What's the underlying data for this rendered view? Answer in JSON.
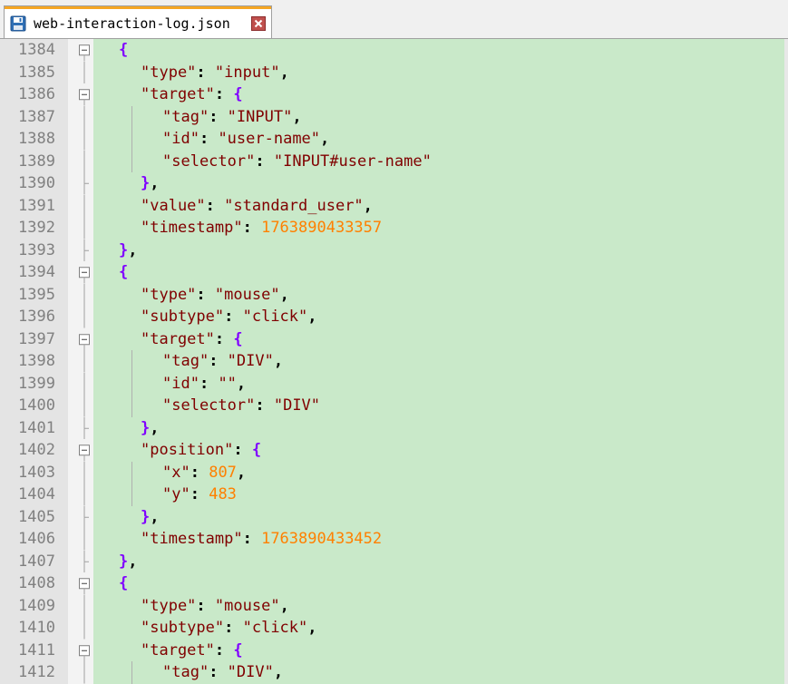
{
  "tab": {
    "title": "web-interaction-log.json",
    "save_icon": "floppy-disk-icon",
    "close_icon": "close-icon",
    "accent_color": "#f5a623"
  },
  "editor": {
    "highlight_color": "#c9e9c9",
    "lines": [
      {
        "n": "1384",
        "fold": "open",
        "indent": 1,
        "tokens": [
          {
            "t": "brace",
            "v": "{"
          }
        ]
      },
      {
        "n": "1385",
        "fold": "line",
        "indent": 2,
        "tokens": [
          {
            "t": "key",
            "v": "\"type\""
          },
          {
            "t": "punc",
            "v": ": "
          },
          {
            "t": "str",
            "v": "\"input\""
          },
          {
            "t": "punc",
            "v": ","
          }
        ]
      },
      {
        "n": "1386",
        "fold": "open",
        "indent": 2,
        "tokens": [
          {
            "t": "key",
            "v": "\"target\""
          },
          {
            "t": "punc",
            "v": ": "
          },
          {
            "t": "brace",
            "v": "{"
          }
        ]
      },
      {
        "n": "1387",
        "fold": "line",
        "indent": 3,
        "tokens": [
          {
            "t": "key",
            "v": "\"tag\""
          },
          {
            "t": "punc",
            "v": ": "
          },
          {
            "t": "str",
            "v": "\"INPUT\""
          },
          {
            "t": "punc",
            "v": ","
          }
        ]
      },
      {
        "n": "1388",
        "fold": "line",
        "indent": 3,
        "tokens": [
          {
            "t": "key",
            "v": "\"id\""
          },
          {
            "t": "punc",
            "v": ": "
          },
          {
            "t": "str",
            "v": "\"user-name\""
          },
          {
            "t": "punc",
            "v": ","
          }
        ]
      },
      {
        "n": "1389",
        "fold": "line",
        "indent": 3,
        "tokens": [
          {
            "t": "key",
            "v": "\"selector\""
          },
          {
            "t": "punc",
            "v": ": "
          },
          {
            "t": "str",
            "v": "\"INPUT#user-name\""
          }
        ]
      },
      {
        "n": "1390",
        "fold": "end",
        "indent": 2,
        "tokens": [
          {
            "t": "brace",
            "v": "}"
          },
          {
            "t": "punc",
            "v": ","
          }
        ]
      },
      {
        "n": "1391",
        "fold": "line",
        "indent": 2,
        "tokens": [
          {
            "t": "key",
            "v": "\"value\""
          },
          {
            "t": "punc",
            "v": ": "
          },
          {
            "t": "str",
            "v": "\"standard_user\""
          },
          {
            "t": "punc",
            "v": ","
          }
        ]
      },
      {
        "n": "1392",
        "fold": "line",
        "indent": 2,
        "tokens": [
          {
            "t": "key",
            "v": "\"timestamp\""
          },
          {
            "t": "punc",
            "v": ": "
          },
          {
            "t": "num",
            "v": "1763890433357"
          }
        ]
      },
      {
        "n": "1393",
        "fold": "end",
        "indent": 1,
        "tokens": [
          {
            "t": "brace",
            "v": "}"
          },
          {
            "t": "punc",
            "v": ","
          }
        ]
      },
      {
        "n": "1394",
        "fold": "open",
        "indent": 1,
        "tokens": [
          {
            "t": "brace",
            "v": "{"
          }
        ]
      },
      {
        "n": "1395",
        "fold": "line",
        "indent": 2,
        "tokens": [
          {
            "t": "key",
            "v": "\"type\""
          },
          {
            "t": "punc",
            "v": ": "
          },
          {
            "t": "str",
            "v": "\"mouse\""
          },
          {
            "t": "punc",
            "v": ","
          }
        ]
      },
      {
        "n": "1396",
        "fold": "line",
        "indent": 2,
        "tokens": [
          {
            "t": "key",
            "v": "\"subtype\""
          },
          {
            "t": "punc",
            "v": ": "
          },
          {
            "t": "str",
            "v": "\"click\""
          },
          {
            "t": "punc",
            "v": ","
          }
        ]
      },
      {
        "n": "1397",
        "fold": "open",
        "indent": 2,
        "tokens": [
          {
            "t": "key",
            "v": "\"target\""
          },
          {
            "t": "punc",
            "v": ": "
          },
          {
            "t": "brace",
            "v": "{"
          }
        ]
      },
      {
        "n": "1398",
        "fold": "line",
        "indent": 3,
        "tokens": [
          {
            "t": "key",
            "v": "\"tag\""
          },
          {
            "t": "punc",
            "v": ": "
          },
          {
            "t": "str",
            "v": "\"DIV\""
          },
          {
            "t": "punc",
            "v": ","
          }
        ]
      },
      {
        "n": "1399",
        "fold": "line",
        "indent": 3,
        "tokens": [
          {
            "t": "key",
            "v": "\"id\""
          },
          {
            "t": "punc",
            "v": ": "
          },
          {
            "t": "str",
            "v": "\"\""
          },
          {
            "t": "punc",
            "v": ","
          }
        ]
      },
      {
        "n": "1400",
        "fold": "line",
        "indent": 3,
        "tokens": [
          {
            "t": "key",
            "v": "\"selector\""
          },
          {
            "t": "punc",
            "v": ": "
          },
          {
            "t": "str",
            "v": "\"DIV\""
          }
        ]
      },
      {
        "n": "1401",
        "fold": "end",
        "indent": 2,
        "tokens": [
          {
            "t": "brace",
            "v": "}"
          },
          {
            "t": "punc",
            "v": ","
          }
        ]
      },
      {
        "n": "1402",
        "fold": "open",
        "indent": 2,
        "tokens": [
          {
            "t": "key",
            "v": "\"position\""
          },
          {
            "t": "punc",
            "v": ": "
          },
          {
            "t": "brace",
            "v": "{"
          }
        ]
      },
      {
        "n": "1403",
        "fold": "line",
        "indent": 3,
        "tokens": [
          {
            "t": "key",
            "v": "\"x\""
          },
          {
            "t": "punc",
            "v": ": "
          },
          {
            "t": "num",
            "v": "807"
          },
          {
            "t": "punc",
            "v": ","
          }
        ]
      },
      {
        "n": "1404",
        "fold": "line",
        "indent": 3,
        "tokens": [
          {
            "t": "key",
            "v": "\"y\""
          },
          {
            "t": "punc",
            "v": ": "
          },
          {
            "t": "num",
            "v": "483"
          }
        ]
      },
      {
        "n": "1405",
        "fold": "end",
        "indent": 2,
        "tokens": [
          {
            "t": "brace",
            "v": "}"
          },
          {
            "t": "punc",
            "v": ","
          }
        ]
      },
      {
        "n": "1406",
        "fold": "line",
        "indent": 2,
        "tokens": [
          {
            "t": "key",
            "v": "\"timestamp\""
          },
          {
            "t": "punc",
            "v": ": "
          },
          {
            "t": "num",
            "v": "1763890433452"
          }
        ]
      },
      {
        "n": "1407",
        "fold": "end",
        "indent": 1,
        "tokens": [
          {
            "t": "brace",
            "v": "}"
          },
          {
            "t": "punc",
            "v": ","
          }
        ]
      },
      {
        "n": "1408",
        "fold": "open",
        "indent": 1,
        "tokens": [
          {
            "t": "brace",
            "v": "{"
          }
        ]
      },
      {
        "n": "1409",
        "fold": "line",
        "indent": 2,
        "tokens": [
          {
            "t": "key",
            "v": "\"type\""
          },
          {
            "t": "punc",
            "v": ": "
          },
          {
            "t": "str",
            "v": "\"mouse\""
          },
          {
            "t": "punc",
            "v": ","
          }
        ]
      },
      {
        "n": "1410",
        "fold": "line",
        "indent": 2,
        "tokens": [
          {
            "t": "key",
            "v": "\"subtype\""
          },
          {
            "t": "punc",
            "v": ": "
          },
          {
            "t": "str",
            "v": "\"click\""
          },
          {
            "t": "punc",
            "v": ","
          }
        ]
      },
      {
        "n": "1411",
        "fold": "open",
        "indent": 2,
        "tokens": [
          {
            "t": "key",
            "v": "\"target\""
          },
          {
            "t": "punc",
            "v": ": "
          },
          {
            "t": "brace",
            "v": "{"
          }
        ]
      },
      {
        "n": "1412",
        "fold": "line",
        "indent": 3,
        "tokens": [
          {
            "t": "key",
            "v": "\"tag\""
          },
          {
            "t": "punc",
            "v": ": "
          },
          {
            "t": "str",
            "v": "\"DIV\""
          },
          {
            "t": "punc",
            "v": ","
          }
        ]
      }
    ]
  }
}
